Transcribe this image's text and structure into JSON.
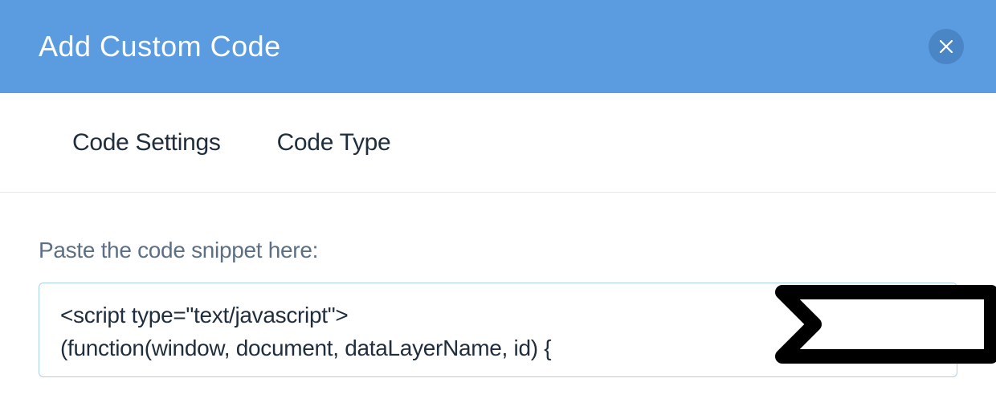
{
  "header": {
    "title": "Add Custom Code"
  },
  "tabs": {
    "codeSettings": "Code Settings",
    "codeType": "Code Type"
  },
  "content": {
    "label": "Paste the code snippet here:",
    "codeSnippet": "<script type=\"text/javascript\">\n(function(window, document, dataLayerName, id) {"
  }
}
